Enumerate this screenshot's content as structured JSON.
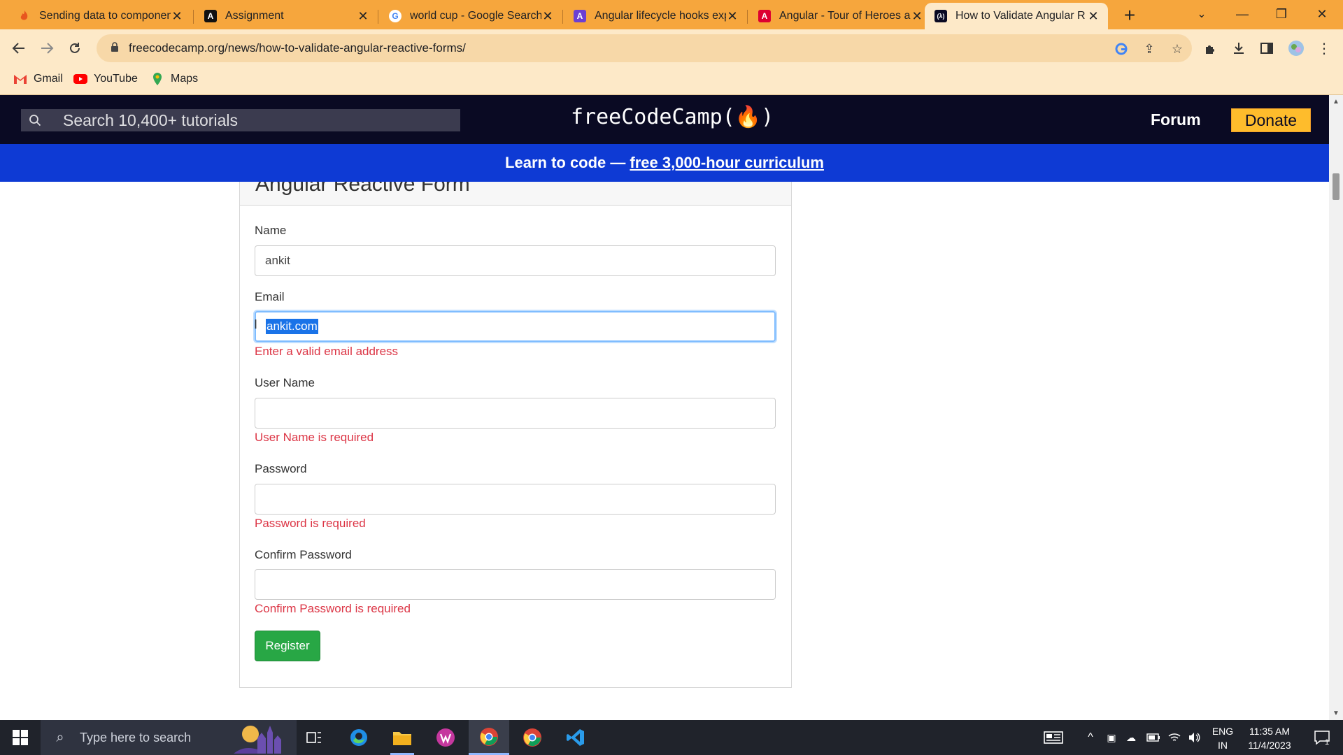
{
  "browser": {
    "tabs": [
      {
        "title": "Sending data to componen",
        "favicon_color": "#f47b20",
        "favicon": "flame-favicon"
      },
      {
        "title": "Assignment",
        "favicon_color": "#111111",
        "favicon": "angular-a-favicon"
      },
      {
        "title": "world cup - Google Search",
        "favicon_color": "#4285f4",
        "favicon": "google-g-favicon"
      },
      {
        "title": "Angular lifecycle hooks exp",
        "favicon_color": "#6c3fd3",
        "favicon": "angular-a-favicon"
      },
      {
        "title": "Angular - Tour of Heroes a",
        "favicon_color": "#dd0031",
        "favicon": "angular-a-favicon"
      },
      {
        "title": "How to Validate Angular R",
        "favicon_color": "#0a0a23",
        "favicon": "freecodecamp-favicon",
        "active": true
      }
    ],
    "url": "freecodecamp.org/news/how-to-validate-angular-reactive-forms/",
    "bookmarks": [
      {
        "label": "Gmail",
        "icon": "gmail-icon"
      },
      {
        "label": "YouTube",
        "icon": "youtube-icon"
      },
      {
        "label": "Maps",
        "icon": "maps-icon"
      }
    ]
  },
  "site": {
    "search_placeholder": "Search 10,400+ tutorials",
    "logo": "freeCodeCamp(🔥)",
    "forum": "Forum",
    "donate": "Donate",
    "banner_prefix": "Learn to code — ",
    "banner_link": "free 3,000-hour curriculum"
  },
  "form": {
    "header": "Angular Reactive Form",
    "fields": [
      {
        "label": "Name",
        "value": "ankit",
        "error": ""
      },
      {
        "label": "Email",
        "value": "ankit.com",
        "error": "Enter a valid email address",
        "focused": true
      },
      {
        "label": "User Name",
        "value": "",
        "error": "User Name is required"
      },
      {
        "label": "Password",
        "value": "",
        "error": "Password is required"
      },
      {
        "label": "Confirm Password",
        "value": "",
        "error": "Confirm Password is required"
      }
    ],
    "submit": "Register"
  },
  "taskbar": {
    "search_placeholder": "Type here to search",
    "language": "ENG",
    "region": "IN",
    "time": "11:35 AM",
    "date": "11/4/2023",
    "notification_count": "1"
  },
  "colors": {
    "tabstrip": "#f6a63d",
    "fcc_nav": "#0a0a23",
    "banner": "#0e3ad4",
    "donate": "#febc2c",
    "error": "#dc3545",
    "register": "#28a745"
  }
}
